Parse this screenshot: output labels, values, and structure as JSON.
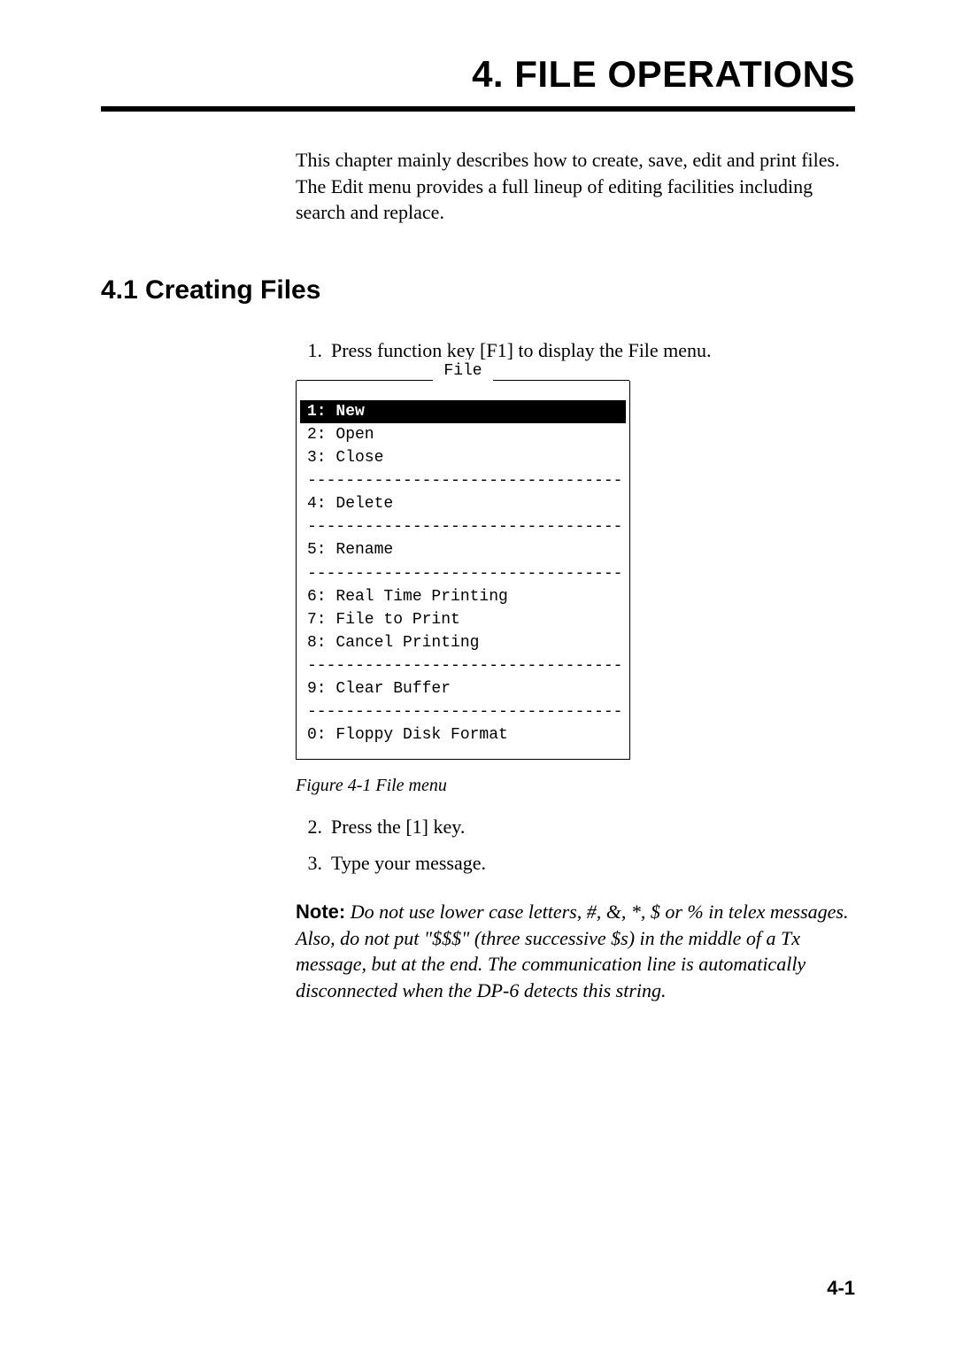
{
  "chapter": {
    "title": "4. FILE OPERATIONS",
    "intro": "This chapter mainly describes how to create, save, edit and print files. The Edit menu provides a full lineup of editing facilities including search and replace."
  },
  "section": {
    "title": "4.1 Creating Files",
    "steps": [
      {
        "num": "1.",
        "text": "Press function key [F1] to display the File menu."
      },
      {
        "num": "2.",
        "text": "Press the [1] key."
      },
      {
        "num": "3.",
        "text": "Type your message."
      }
    ]
  },
  "file_menu": {
    "label": "File",
    "divider": "------------------------------------------",
    "groups": [
      [
        {
          "text": "1: New",
          "selected": true
        },
        {
          "text": "2: Open",
          "selected": false
        },
        {
          "text": "3: Close",
          "selected": false
        }
      ],
      [
        {
          "text": "4: Delete",
          "selected": false
        }
      ],
      [
        {
          "text": "5: Rename",
          "selected": false
        }
      ],
      [
        {
          "text": "6: Real Time Printing",
          "selected": false
        },
        {
          "text": "7: File to Print",
          "selected": false
        },
        {
          "text": "8: Cancel Printing",
          "selected": false
        }
      ],
      [
        {
          "text": "9: Clear Buffer",
          "selected": false
        }
      ],
      [
        {
          "text": "0: Floppy Disk Format",
          "selected": false
        }
      ]
    ]
  },
  "figure_caption": "Figure 4-1 File menu",
  "note": {
    "label": "Note:",
    "body": " Do not use lower case letters, #, &, *, $ or % in telex messages. Also, do not put \"$$$\" (three successive $s) in the middle of a Tx message, but at the end. The communication line is automatically disconnected when the DP-6 detects this string."
  },
  "page_number": "4-1"
}
